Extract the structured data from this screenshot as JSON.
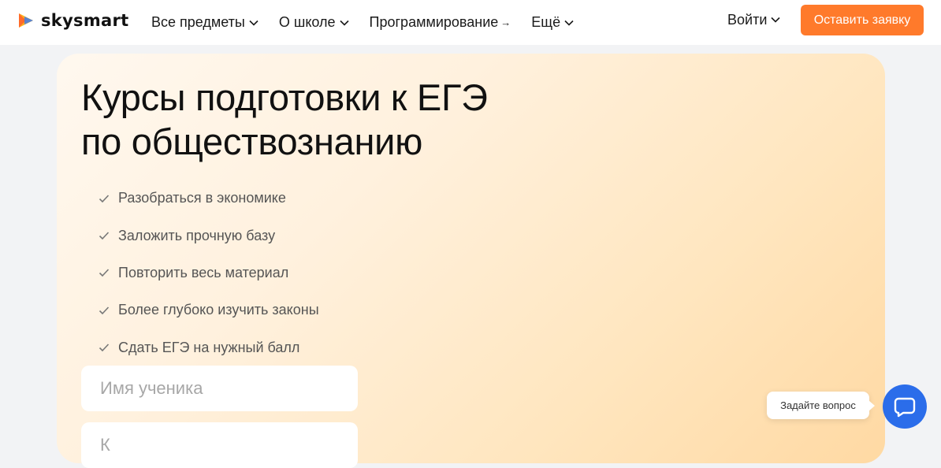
{
  "brand": {
    "name": "skysmart",
    "accent_color": "#ff7a2b"
  },
  "nav": {
    "items": [
      {
        "label": "Все предметы",
        "icon": "chevron-down-icon"
      },
      {
        "label": "О школе",
        "icon": "chevron-down-icon"
      },
      {
        "label": "Программирование",
        "icon": "arrow-right-icon"
      },
      {
        "label": "Ещё",
        "icon": "chevron-down-icon"
      }
    ],
    "login_label": "Войти",
    "cta_label": "Оставить заявку"
  },
  "hero": {
    "title_line1": "Курсы подготовки к ЕГЭ",
    "title_line2": "по обществознанию",
    "features": [
      "Разобраться в экономике",
      "Заложить прочную базу",
      "Повторить весь материал",
      "Более глубоко изучить законы",
      "Сдать ЕГЭ на нужный балл"
    ],
    "form": {
      "student_name_placeholder": "Имя ученика",
      "second_field_placeholder": "К"
    }
  },
  "chat": {
    "tooltip": "Задайте вопрос",
    "button_color": "#2b6dea",
    "icon": "chat-bubble-icon"
  }
}
